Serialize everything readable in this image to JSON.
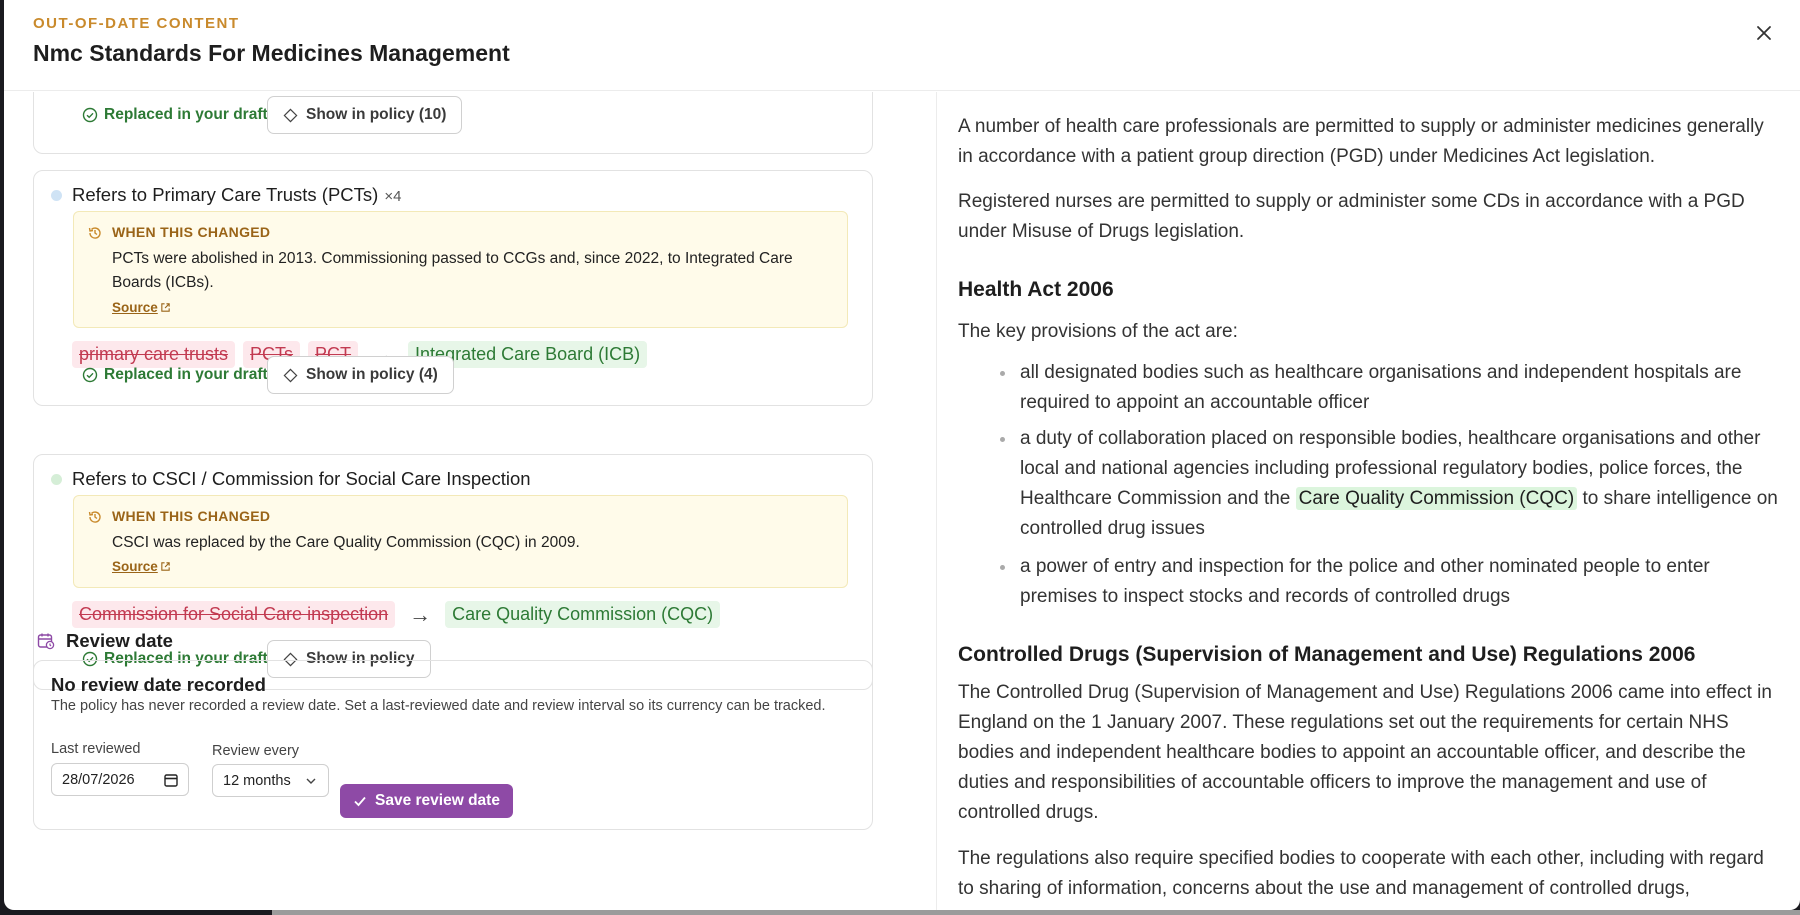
{
  "header": {
    "eyebrow": "OUT-OF-DATE CONTENT",
    "title": "Nmc Standards For Medicines Management"
  },
  "cards": [
    {
      "replaced_label": "Replaced in your draft",
      "show_label": "Show in policy (10)"
    },
    {
      "title": "Refers to Primary Care Trusts (PCTs)",
      "count": "×4",
      "dot_color": "#cfe3f5",
      "changed_label": "WHEN THIS CHANGED",
      "changed_text": "PCTs were abolished in 2013. Commissioning passed to CCGs and, since 2022, to Integrated Care Boards (ICBs).",
      "source_label": "Source",
      "old_terms": [
        "primary care trusts",
        "PCTs",
        "PCT"
      ],
      "new_term": "Integrated Care Board (ICB)",
      "replaced_label": "Replaced in your draft",
      "show_label": "Show in policy (4)"
    },
    {
      "title": "Refers to CSCI / Commission for Social Care Inspection",
      "dot_color": "#d5eed7",
      "changed_label": "WHEN THIS CHANGED",
      "changed_text": "CSCI was replaced by the Care Quality Commission (CQC) in 2009.",
      "source_label": "Source",
      "old_terms": [
        "Commission for Social Care inspection"
      ],
      "new_term": "Care Quality Commission (CQC)",
      "replaced_label": "Replaced in your draft",
      "show_label": "Show in policy"
    }
  ],
  "review": {
    "section_title": "Review date",
    "heading": "No review date recorded",
    "description": "The policy has never recorded a review date. Set a last-reviewed date and review interval so its currency can be tracked.",
    "last_reviewed_label": "Last reviewed",
    "last_reviewed_value": "28/07/2026",
    "interval_label": "Review every",
    "interval_value": "12 months",
    "save_label": "Save review date"
  },
  "document": {
    "p1": "A number of health care professionals are permitted to supply or administer medicines generally in accordance with a patient group direction (PGD) under Medicines Act legislation.",
    "p2": "Registered nurses are permitted to supply or administer some CDs in accordance with a PGD under Misuse of Drugs legislation.",
    "h1": "Health Act 2006",
    "p3": "The key provisions of the act are:",
    "bullets": [
      "all designated bodies such as healthcare organisations and independent hospitals are required to appoint an accountable officer",
      "a duty of collaboration placed on responsible bodies, healthcare organisations and other local and national agencies including professional regulatory bodies, police forces, the Healthcare Commission and the",
      "a power of entry and inspection for the police and other nominated people to enter premises to inspect stocks and records of controlled drugs"
    ],
    "bullet2_highlight": "Care Quality Commission (CQC)",
    "bullet2_tail": "to share intelligence on controlled drug issues",
    "h2": "Controlled Drugs (Supervision of Management and Use) Regulations 2006",
    "p4": "The Controlled Drug (Supervision of Management and Use) Regulations 2006 came into effect in England on the 1 January 2007. These regulations set out the requirements for certain NHS bodies and independent healthcare bodies to appoint an accountable officer, and describe the duties and responsibilities of accountable officers to improve the management and use of controlled drugs.",
    "p5": "The regulations also require specified bodies to cooperate with each other, including with regard to sharing of information, concerns about the use and management of controlled drugs,"
  }
}
